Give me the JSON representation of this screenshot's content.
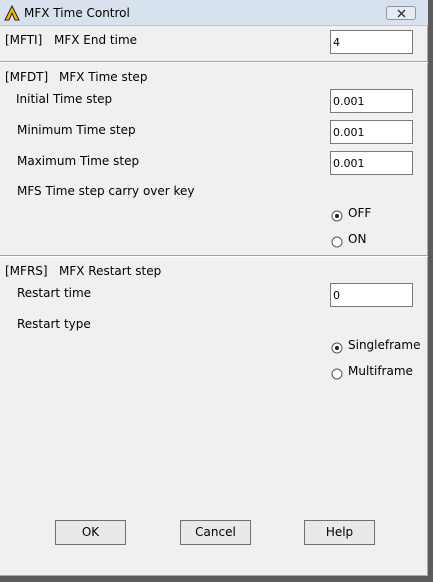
{
  "window": {
    "title": "MFX Time Control"
  },
  "mfti": {
    "tag": "[MFTI]",
    "label": "MFX End time",
    "value": "4"
  },
  "mfdt": {
    "tag": "[MFDT]",
    "label": "MFX Time step",
    "initial_label": "Initial Time step",
    "initial_value": "0.001",
    "min_label": "Minimum Time step",
    "min_value": "0.001",
    "max_label": "Maximum Time step",
    "max_value": "0.001",
    "carry_label": "MFS Time step carry over key",
    "carry_options": [
      "OFF",
      "ON"
    ],
    "carry_selected": "OFF"
  },
  "mfrs": {
    "tag": "[MFRS]",
    "label": "MFX Restart step",
    "restart_time_label": "Restart time",
    "restart_time_value": "0",
    "restart_type_label": "Restart type",
    "restart_type_options": [
      "Singleframe",
      "Multiframe"
    ],
    "restart_type_selected": "Singleframe"
  },
  "buttons": {
    "ok": "OK",
    "cancel": "Cancel",
    "help": "Help"
  }
}
